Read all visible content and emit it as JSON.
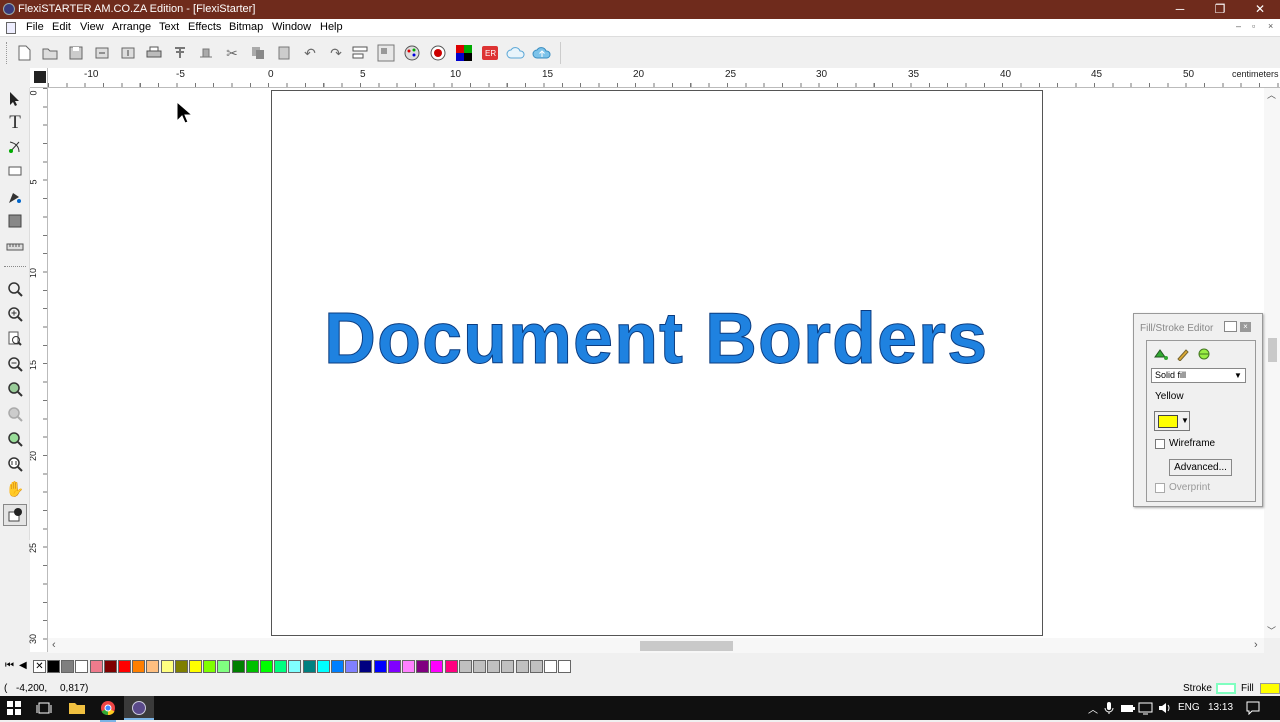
{
  "window": {
    "title": "FlexiSTARTER AM.CO.ZA Edition - [FlexiStarter]",
    "minimize": "─",
    "restore": "❐",
    "close": "✕"
  },
  "menu": {
    "items": [
      "File",
      "Edit",
      "View",
      "Arrange",
      "Text",
      "Effects",
      "Bitmap",
      "Window",
      "Help"
    ],
    "mdi_min": "–",
    "mdi_restore": "▫",
    "mdi_close": "×"
  },
  "toolbar": {
    "icons": [
      "new-document-icon",
      "open-icon",
      "save-icon",
      "import-icon",
      "export-icon",
      "print-icon",
      "cut-contour-icon",
      "send-to-cutter-icon",
      "cut-icon",
      "copy-icon",
      "paste-icon",
      "undo-icon",
      "redo-icon",
      "align-icon",
      "arrange-icon",
      "color-wheel-icon",
      "spectrum-icon",
      "palette-icon",
      "er-icon",
      "cloud-icon",
      "cloud-upload-icon"
    ]
  },
  "ruler": {
    "unit": "centimeters",
    "top_ticks": [
      "-10",
      "-5",
      "0",
      "5",
      "10",
      "15",
      "20",
      "25",
      "30",
      "35",
      "40",
      "45",
      "50"
    ],
    "left_ticks": [
      "0",
      "5",
      "10",
      "15",
      "20",
      "25",
      "30"
    ]
  },
  "tools": [
    "select-tool-icon",
    "text-tool-icon",
    "shape-edit-tool-icon",
    "rectangle-tool-icon",
    "pen-tool-icon",
    "fill-tool-icon",
    "measure-tool-icon",
    "zoom-tool-icon",
    "zoom-in-icon",
    "zoom-page-icon",
    "zoom-out-icon",
    "zoom-fit-icon",
    "zoom-selected-icon",
    "zoom-all-icon",
    "zoom-actual-icon",
    "hand-tool-icon",
    "fill-stroke-tool-icon"
  ],
  "document": {
    "text": "Document Borders",
    "text_color": "#1f82e0",
    "outline_color": "#0b3c80"
  },
  "fill_stroke_editor": {
    "title": "Fill/Stroke Editor",
    "fill_type": "Solid fill",
    "color_name": "Yellow",
    "color": "#ffff00",
    "wireframe_label": "Wireframe",
    "advanced_label": "Advanced...",
    "overprint_label": "Overprint"
  },
  "palette": {
    "colors": [
      "#000000",
      "#7f7f7f",
      "#ffffff",
      "#ef7b8c",
      "#7f0000",
      "#ff0000",
      "#ff7f00",
      "#ffbf80",
      "#ffff80",
      "#7f7f00",
      "#ffff00",
      "#80ff00",
      "#80ff80",
      "#008000",
      "#00c000",
      "#00ff00",
      "#00ff80",
      "#80ffff",
      "#008080",
      "#00ffff",
      "#0080ff",
      "#8080ff",
      "#000080",
      "#0000ff",
      "#8000ff",
      "#ff80ff",
      "#800080",
      "#ff00ff",
      "#ff0080",
      "#c0c0c0",
      "#c0c0c0",
      "#c0c0c0",
      "#c0c0c0",
      "#c0c0c0",
      "#c0c0c0",
      "#ffffff",
      "#ffffff"
    ]
  },
  "status": {
    "coords_x": "-4,200,",
    "coords_y": "0,817)",
    "open_paren": "(",
    "stroke_label": "Stroke",
    "fill_label": "Fill",
    "stroke_color": "#80ffc0",
    "fill_color": "#ffff00"
  },
  "taskbar": {
    "lang": "ENG",
    "time": "13:13"
  }
}
